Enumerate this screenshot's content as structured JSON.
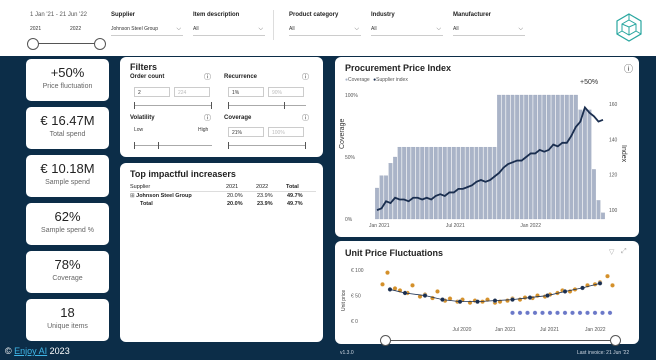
{
  "filters_top": {
    "date_label": "1 Jan '21 - 21 Jun '22",
    "year_from": "2021",
    "year_to": "2022",
    "supplier_label": "Supplier",
    "supplier_value": "Johnson Steel Group",
    "item_label": "Item description",
    "item_value": "All",
    "category_label": "Product category",
    "category_value": "All",
    "industry_label": "Industry",
    "industry_value": "All",
    "manufacturer_label": "Manufacturer",
    "manufacturer_value": "All"
  },
  "kpis": [
    {
      "value": "+50%",
      "label": "Price fluctuation"
    },
    {
      "value": "€ 16.47M",
      "label": "Total spend"
    },
    {
      "value": "€ 10.18M",
      "label": "Sample spend"
    },
    {
      "value": "62%",
      "label": "Sample spend %"
    },
    {
      "value": "78%",
      "label": "Coverage"
    },
    {
      "value": "18",
      "label": "Unique items"
    }
  ],
  "filters_panel": {
    "title": "Filters",
    "order_count_label": "Order count",
    "order_count_min": "2",
    "order_count_max": "224",
    "recurrence_label": "Recurrence",
    "recurrence_min": "1%",
    "recurrence_max": "90%",
    "volatility_label": "Volatility",
    "volatility_low": "Low",
    "volatility_high": "High",
    "coverage_label": "Coverage",
    "coverage_min": "21%",
    "coverage_max": "100%"
  },
  "increasers": {
    "title": "Top impactful increasers",
    "columns": [
      "Supplier",
      "2021",
      "2022",
      "Total"
    ],
    "rows": [
      {
        "supplier": "Johnson Steel Group",
        "y2021": "20.0%",
        "y2022": "23.9%",
        "total": "49.7%"
      },
      {
        "supplier": "Total",
        "y2021": "20.0%",
        "y2022": "23.9%",
        "total": "49.7%"
      }
    ]
  },
  "ppi": {
    "title": "Procurement Price Index",
    "legend_coverage": "Coverage",
    "legend_supplier": "Supplier index",
    "annotation": "+50%",
    "left_axis_title": "Coverage",
    "right_axis_title": "Index"
  },
  "upf": {
    "title": "Unit Price Fluctuations",
    "y_axis_title": "Unit price"
  },
  "chart_data": [
    {
      "type": "area",
      "title": "Procurement Price Index",
      "x_ticks": [
        "Jan 2021",
        "Jul 2021",
        "Jan 2022"
      ],
      "left_ticks": [
        "100%",
        "50%",
        "0%"
      ],
      "right_ticks": [
        "160",
        "140",
        "120",
        "100"
      ],
      "ylim_left": [
        0,
        100
      ],
      "ylim_right": [
        95,
        165
      ],
      "series": [
        {
          "name": "Coverage",
          "color": "#aab4c8",
          "x": [
            0,
            2,
            4,
            6,
            8,
            10,
            12,
            14,
            16,
            18,
            20,
            22,
            24,
            26,
            28,
            30,
            32,
            34,
            36,
            38,
            40,
            42,
            44,
            46,
            48,
            50,
            52,
            54,
            56,
            58,
            60,
            62,
            64,
            66,
            68,
            70,
            72,
            74,
            76,
            78,
            80,
            82,
            84,
            86,
            88,
            90,
            92,
            94,
            96,
            98,
            100
          ],
          "values": [
            25,
            35,
            35,
            45,
            50,
            58,
            58,
            58,
            58,
            58,
            58,
            58,
            58,
            58,
            58,
            58,
            58,
            58,
            58,
            58,
            58,
            58,
            58,
            58,
            58,
            58,
            58,
            100,
            100,
            100,
            100,
            100,
            100,
            100,
            100,
            100,
            100,
            100,
            100,
            100,
            100,
            100,
            100,
            100,
            100,
            88,
            88,
            88,
            40,
            15,
            5
          ]
        },
        {
          "name": "Supplier index",
          "color": "#1a2e4f",
          "x": [
            0,
            2,
            4,
            6,
            8,
            10,
            12,
            14,
            16,
            18,
            20,
            22,
            24,
            26,
            28,
            30,
            32,
            34,
            36,
            38,
            40,
            42,
            44,
            46,
            48,
            50,
            52,
            54,
            56,
            58,
            60,
            62,
            64,
            66,
            68,
            70,
            72,
            74,
            76,
            78,
            80,
            82,
            84,
            86,
            88,
            90,
            92,
            94,
            96,
            98,
            100
          ],
          "values": [
            100,
            101,
            105,
            104,
            107,
            106,
            106,
            105,
            107,
            107,
            106,
            107,
            106,
            108,
            109,
            108,
            110,
            110,
            112,
            112,
            113,
            114,
            116,
            117,
            116,
            117,
            119,
            121,
            124,
            126,
            127,
            128,
            128,
            130,
            132,
            132,
            134,
            133,
            134,
            137,
            136,
            138,
            138,
            142,
            147,
            150,
            158,
            155,
            153,
            150,
            151
          ]
        }
      ]
    },
    {
      "type": "scatter",
      "title": "Unit Price Fluctuations",
      "ylabel": "Unit price",
      "x_ticks": [
        "Jul 2020",
        "Jan 2021",
        "Jul 2021",
        "Jan 2022"
      ],
      "y_ticks": [
        "€ 100",
        "€ 50",
        "€ 0"
      ],
      "ylim": [
        0,
        110
      ],
      "series": [
        {
          "name": "",
          "color": "#d4902a",
          "x": [
            3,
            5,
            8,
            10,
            13,
            15,
            18,
            20,
            23,
            25,
            28,
            30,
            33,
            35,
            38,
            40,
            43,
            45,
            48,
            50,
            53,
            55,
            58,
            60,
            63,
            65,
            68,
            70,
            73,
            75,
            78,
            80,
            83,
            85,
            88,
            90,
            93,
            95
          ],
          "values": [
            72,
            95,
            64,
            60,
            55,
            70,
            48,
            52,
            45,
            58,
            40,
            44,
            38,
            42,
            36,
            40,
            38,
            42,
            36,
            38,
            40,
            44,
            42,
            46,
            45,
            50,
            48,
            52,
            55,
            60,
            58,
            62,
            65,
            70,
            72,
            76,
            88,
            70
          ]
        },
        {
          "name": "",
          "color": "#1a2e4f",
          "x": [
            6,
            12,
            20,
            27,
            34,
            41,
            48,
            55,
            62,
            69,
            76,
            83,
            90
          ],
          "values": [
            62,
            55,
            50,
            42,
            38,
            38,
            40,
            42,
            46,
            50,
            58,
            65,
            74
          ]
        },
        {
          "name": "",
          "color": "#6b78c8",
          "x": [
            55,
            58,
            61,
            64,
            67,
            70,
            73,
            76,
            79,
            82,
            85,
            88,
            91,
            94
          ],
          "values": [
            16,
            16,
            16,
            16,
            16,
            16,
            16,
            16,
            16,
            16,
            16,
            16,
            16,
            16
          ]
        }
      ]
    }
  ],
  "footer": {
    "brand_prefix": "© ",
    "brand_name": "Enjoy AI",
    "brand_year": " 2023",
    "version": "v1.3.0",
    "last_invoice": "Last invoice: 21 Jun '22"
  }
}
